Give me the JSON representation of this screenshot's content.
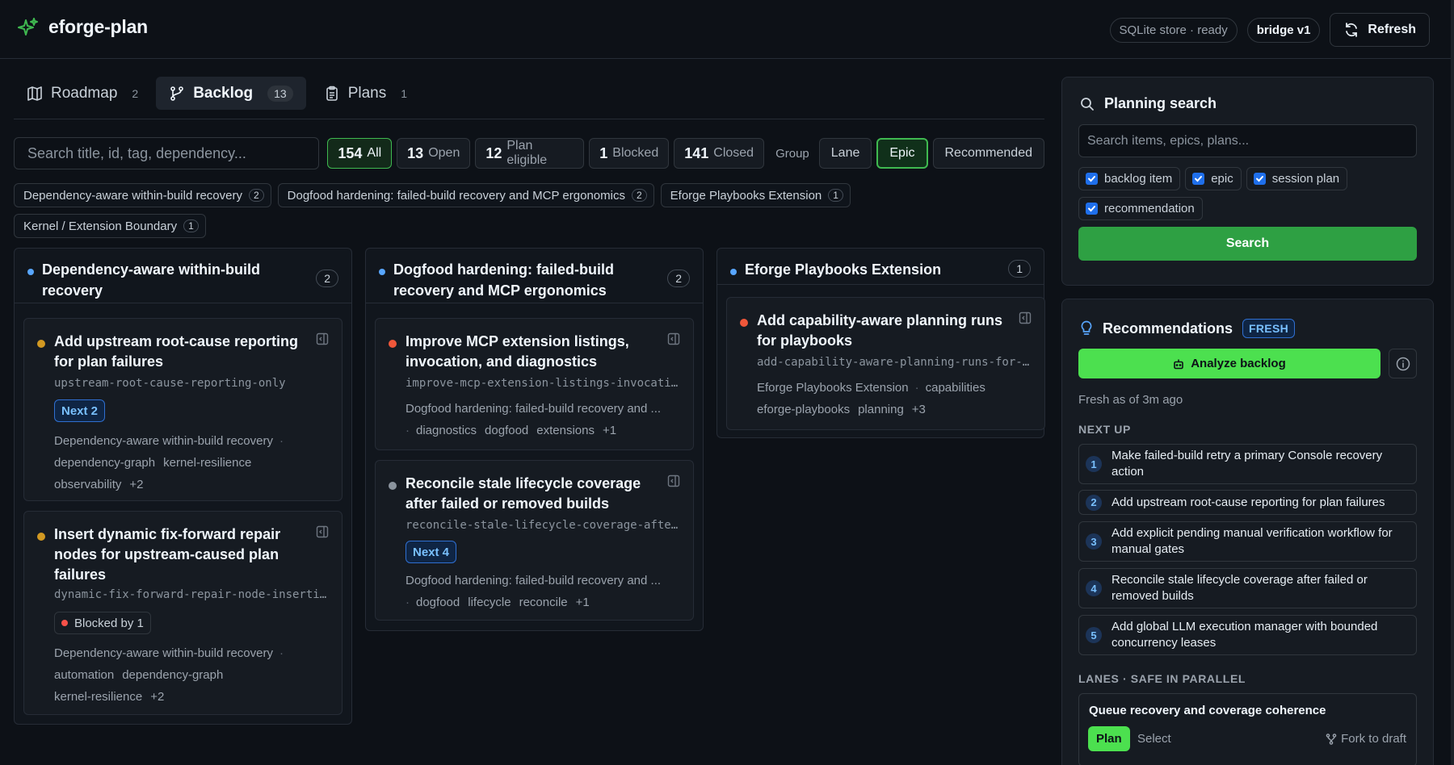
{
  "app": {
    "name": "eforge-plan"
  },
  "status": {
    "store": "SQLite store · ready",
    "bridge": "bridge v1",
    "refresh_label": "Refresh"
  },
  "tabs": [
    {
      "label": "Roadmap",
      "count": "2"
    },
    {
      "label": "Backlog",
      "count": "13"
    },
    {
      "label": "Plans",
      "count": "1"
    }
  ],
  "filters": {
    "search_placeholder": "Search title, id, tag, dependency...",
    "status_chips": [
      {
        "count": "154",
        "label": "All"
      },
      {
        "count": "13",
        "label": "Open"
      },
      {
        "count": "12",
        "label": "Plan eligible"
      },
      {
        "count": "1",
        "label": "Blocked"
      },
      {
        "count": "141",
        "label": "Closed"
      }
    ],
    "group_label": "Group",
    "group_options": [
      "Lane",
      "Epic",
      "Recommended"
    ],
    "group_selected": "Epic"
  },
  "epic_chips": [
    {
      "label": "Dependency-aware within-build recovery",
      "count": "2"
    },
    {
      "label": "Dogfood hardening: failed-build recovery and MCP ergonomics",
      "count": "2"
    },
    {
      "label": "Eforge Playbooks Extension",
      "count": "1"
    },
    {
      "label": "Kernel / Extension Boundary",
      "count": "1"
    }
  ],
  "columns": [
    {
      "title": "Dependency-aware within-build recovery",
      "count": "2",
      "cards": [
        {
          "title": "Add upstream root-cause reporting for plan failures",
          "slug": "upstream-root-cause-reporting-only",
          "badge": "Next 2",
          "epic": "Dependency-aware within-build recovery",
          "tags": [
            "dependency-graph",
            "kernel-resilience",
            "observability"
          ],
          "more": "+2"
        },
        {
          "title": "Insert dynamic fix-forward repair nodes for upstream-caused plan failures",
          "slug": "dynamic-fix-forward-repair-node-insertion",
          "badge": "Blocked by 1",
          "epic": "Dependency-aware within-build recovery",
          "tags": [
            "automation",
            "dependency-graph",
            "kernel-resilience"
          ],
          "more": "+2"
        }
      ]
    },
    {
      "title": "Dogfood hardening: failed-build recovery and MCP ergonomics",
      "count": "2",
      "cards": [
        {
          "title": "Improve MCP extension listings, invocation, and diagnostics",
          "slug": "improve-mcp-extension-listings-invocation-and-diagnostics",
          "epic": "Dogfood hardening: failed-build recovery and ...",
          "tags": [
            "diagnostics",
            "dogfood",
            "extensions"
          ],
          "more": "+1"
        },
        {
          "title": "Reconcile stale lifecycle coverage after failed or removed builds",
          "slug": "reconcile-stale-lifecycle-coverage-after-failed-builds",
          "badge": "Next 4",
          "epic": "Dogfood hardening: failed-build recovery and ...",
          "tags": [
            "dogfood",
            "lifecycle",
            "reconcile"
          ],
          "more": "+1"
        }
      ]
    },
    {
      "title": "Eforge Playbooks Extension",
      "count": "1",
      "cards": [
        {
          "title": "Add capability-aware planning runs for playbooks",
          "slug": "add-capability-aware-planning-runs-for-playbooks",
          "epic": "Eforge Playbooks Extension",
          "tags": [
            "capabilities",
            "eforge-playbooks",
            "planning"
          ],
          "more": "+3"
        }
      ]
    }
  ],
  "planning_search": {
    "title": "Planning search",
    "placeholder": "Search items, epics, plans...",
    "types": [
      "backlog item",
      "epic",
      "session plan",
      "recommendation"
    ],
    "button": "Search"
  },
  "recommendations": {
    "title": "Recommendations",
    "badge": "FRESH",
    "analyze_label": "Analyze backlog",
    "freshness": "Fresh as of 3m ago",
    "next_up_label": "NEXT UP",
    "next_up": [
      {
        "n": "1",
        "text": "Make failed-build retry a primary Console recovery action"
      },
      {
        "n": "2",
        "text": "Add upstream root-cause reporting for plan failures"
      },
      {
        "n": "3",
        "text": "Add explicit pending manual verification workflow for manual gates"
      },
      {
        "n": "4",
        "text": "Reconcile stale lifecycle coverage after failed or removed builds"
      },
      {
        "n": "5",
        "text": "Add global LLM execution manager with bounded concurrency leases"
      }
    ],
    "lanes_label": "LANES · SAFE IN PARALLEL",
    "lane": {
      "title": "Queue recovery and coverage coherence",
      "plan": "Plan",
      "select": "Select",
      "fork": "Fork to draft"
    }
  },
  "colors": {
    "accent_green": "#3fb950",
    "bright_green": "#4ce04f",
    "blue": "#58a6ff",
    "red": "#f85149",
    "amber": "#d29922",
    "gray": "#8b949e"
  }
}
